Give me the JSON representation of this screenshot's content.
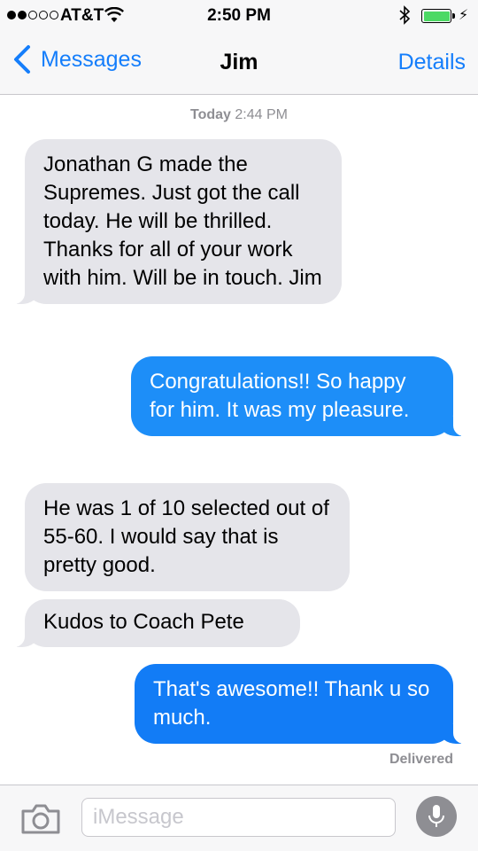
{
  "status": {
    "carrier": "AT&T",
    "time": "2:50 PM",
    "charge_symbol": "⚡"
  },
  "nav": {
    "back_label": "Messages",
    "title": "Jim",
    "details_label": "Details"
  },
  "thread": {
    "day": "Today",
    "time": "2:44 PM",
    "messages": [
      {
        "from": "Jim",
        "text": "Jonathan G made the Supremes. Just got the call today. He will be thrilled. Thanks for all of your work with him. Will be in touch. Jim"
      },
      {
        "from": "me",
        "text": "Congratulations!! So happy for him. It was my pleasure."
      },
      {
        "from": "Jim",
        "text": "He was 1 of 10 selected out of 55-60. I would say that is pretty good."
      },
      {
        "from": "Jim",
        "text": "Kudos to Coach Pete"
      },
      {
        "from": "me",
        "text": "That's awesome!! Thank u so much."
      }
    ],
    "delivered": "Delivered"
  },
  "composer": {
    "placeholder": "iMessage"
  },
  "colors": {
    "accent": "#157efb",
    "outgoing": "#1d8ef8",
    "incoming": "#e5e5ea",
    "battery": "#4cd964"
  }
}
